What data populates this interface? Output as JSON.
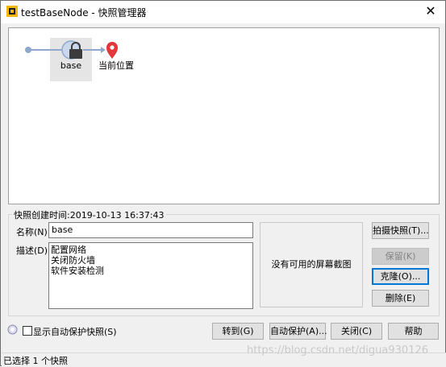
{
  "window": {
    "title": "testBaseNode - 快照管理器",
    "close_glyph": "✕"
  },
  "tree": {
    "node_label": "base",
    "current_label": "当前位置",
    "colors": {
      "line": "#8fa8cc",
      "selected_bg": "#e5e5e5",
      "pin": "#e0383b"
    }
  },
  "details": {
    "created_label": "快照创建时间:",
    "created_value": "2019-10-13 16:37:43",
    "name_label": "名称(N):",
    "name_value": "base",
    "desc_label": "描述(D):",
    "desc_lines": [
      "配置网络",
      "关闭防火墙",
      "软件安装检测"
    ],
    "preview_text": "没有可用的屏幕截图"
  },
  "side_buttons": {
    "take": "拍摄快照(T)...",
    "keep": "保留(K)",
    "clone": "克隆(O)...",
    "delete": "删除(E)"
  },
  "bottom": {
    "show_auto_protect": "显示自动保护快照(S)",
    "goto": "转到(G)",
    "auto_protect": "自动保护(A)...",
    "close": "关闭(C)",
    "help": "帮助"
  },
  "status": {
    "text": "已选择 1 个快照"
  },
  "watermark": "https://blog.csdn.net/digua930126"
}
